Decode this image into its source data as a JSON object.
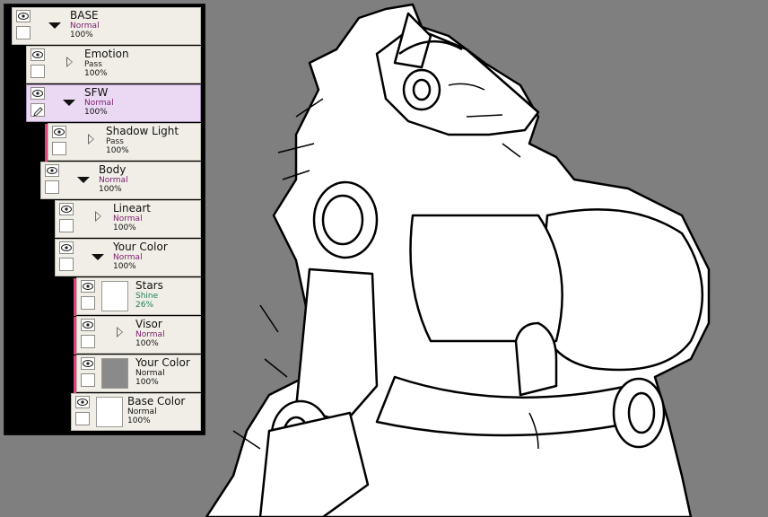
{
  "layers": [
    {
      "name": "BASE",
      "mode": "Normal",
      "opacity": "100%"
    },
    {
      "name": "Emotion",
      "mode": "Pass",
      "opacity": "100%"
    },
    {
      "name": "SFW",
      "mode": "Normal",
      "opacity": "100%"
    },
    {
      "name": "Shadow Light",
      "mode": "Pass",
      "opacity": "100%"
    },
    {
      "name": "Body",
      "mode": "Normal",
      "opacity": "100%"
    },
    {
      "name": "Lineart",
      "mode": "Normal",
      "opacity": "100%"
    },
    {
      "name": "Your Color",
      "mode": "Normal",
      "opacity": "100%"
    },
    {
      "name": "Stars",
      "mode": "Shine",
      "opacity": "26%"
    },
    {
      "name": "Visor",
      "mode": "Normal",
      "opacity": "100%"
    },
    {
      "name": "Your Color",
      "mode": "Normal",
      "opacity": "100%"
    },
    {
      "name": "Base Color",
      "mode": "Normal",
      "opacity": "100%"
    }
  ],
  "colors": {
    "canvas_bg": "#7f7f7f",
    "selected_layer": "#ebd8f3",
    "clip_marker": "#e0427a",
    "blend_mode": "#7a1b6e"
  }
}
